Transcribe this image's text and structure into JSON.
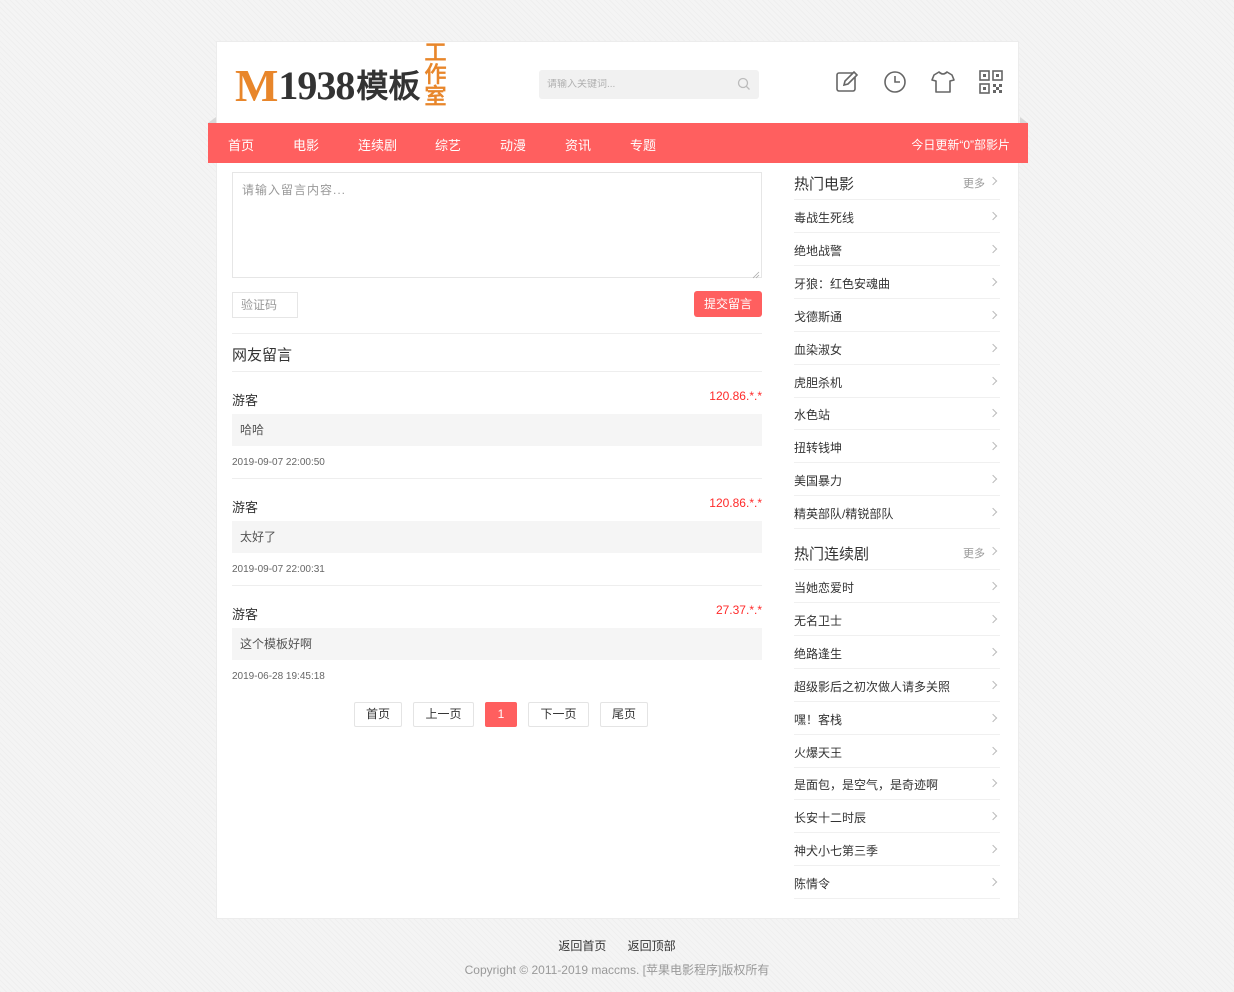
{
  "header": {
    "logo_m": "M",
    "logo_num": "1938",
    "logo_cn": "模板",
    "logo_cn2": "工作室",
    "search_placeholder": "请输入关键词...",
    "icons": [
      "edit-icon",
      "history-icon",
      "skin-icon",
      "qrcode-icon"
    ]
  },
  "nav": {
    "items": [
      "首页",
      "电影",
      "连续剧",
      "综艺",
      "动漫",
      "资讯",
      "专题"
    ],
    "today_update": "今日更新“0”部影片"
  },
  "form": {
    "message_placeholder": "请输入留言内容...",
    "captcha_placeholder": "验证码",
    "submit_label": "提交留言"
  },
  "comments": {
    "title": "网友留言",
    "items": [
      {
        "user": "游客",
        "ip": "120.86.*.*",
        "text": "哈哈",
        "time": "2019-09-07 22:00:50"
      },
      {
        "user": "游客",
        "ip": "120.86.*.*",
        "text": "太好了",
        "time": "2019-09-07 22:00:31"
      },
      {
        "user": "游客",
        "ip": "27.37.*.*",
        "text": "这个模板好啊",
        "time": "2019-06-28 19:45:18"
      }
    ]
  },
  "pager": {
    "first": "首页",
    "prev": "上一页",
    "current": "1",
    "next": "下一页",
    "last": "尾页"
  },
  "sidebar": {
    "more_label": "更多",
    "movies": {
      "title": "热门电影",
      "items": [
        "毒战生死线",
        "绝地战警",
        "牙狼：红色安魂曲",
        "戈德斯通",
        "血染淑女",
        "虎胆杀机",
        "水色站",
        "扭转钱坤",
        "美国暴力",
        "精英部队/精锐部队"
      ]
    },
    "series": {
      "title": "热门连续剧",
      "items": [
        "当她恋爱时",
        "无名卫士",
        "绝路逢生",
        "超级影后之初次做人请多关照",
        "嘿！客栈",
        "火爆天王",
        "是面包，是空气，是奇迹啊",
        "长安十二时辰",
        "神犬小七第三季",
        "陈情令"
      ]
    }
  },
  "footer": {
    "home_link": "返回首页",
    "top_link": "返回顶部",
    "copyright": "Copyright © 2011-2019 maccms. [苹果电影程序]版权所有"
  },
  "colors": {
    "accent": "#ff5f5f",
    "logo_orange": "#e8862b",
    "ip_red": "#ff2a2a"
  }
}
